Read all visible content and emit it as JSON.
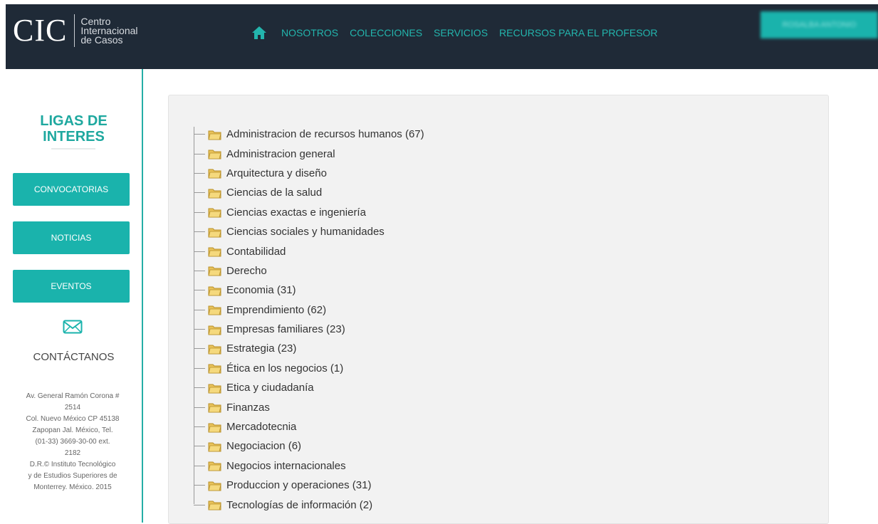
{
  "header": {
    "logo_main": "CIC",
    "logo_line1": "Centro",
    "logo_line2": "Internacional",
    "logo_line3": "de Casos",
    "home_icon": "home-icon",
    "nav_items": [
      "NOSOTROS",
      "COLECCIONES",
      "SERVICIOS",
      "RECURSOS PARA EL PROFESOR"
    ],
    "user_button": "ROSALBA ANTONIO",
    "accent_color": "#1ab3ac",
    "background_color": "#1f2a37"
  },
  "sidebar": {
    "title": "LIGAS DE INTERES",
    "buttons": [
      "CONVOCATORIAS",
      "NOTICIAS",
      "EVENTOS"
    ],
    "mail_icon": "envelope-icon",
    "contact_title": "CONTÁCTANOS",
    "address_lines": [
      "Av. General Ramón Corona #",
      "2514",
      "Col. Nuevo México CP 45138",
      "Zapopan Jal. México, Tel.",
      "(01-33) 3669-30-00 ext.",
      "2182",
      "D.R.© Instituto Tecnológico",
      "y de Estudios Superiores de",
      "Monterrey. México. 2015"
    ]
  },
  "tree": {
    "folder_icon": "folder-icon",
    "items": [
      "Administracion de recursos humanos (67)",
      "Administracion general",
      "Arquitectura y diseño",
      "Ciencias de la salud",
      "Ciencias exactas e ingeniería",
      "Ciencias sociales y humanidades",
      "Contabilidad",
      "Derecho",
      "Economia (31)",
      "Emprendimiento (62)",
      "Empresas familiares (23)",
      "Estrategia (23)",
      "Ética en los negocios (1)",
      "Etica y ciudadanía",
      "Finanzas",
      "Mercadotecnia",
      "Negociacion (6)",
      "Negocios internacionales",
      "Produccion y operaciones (31)",
      "Tecnologías de información (2)"
    ]
  }
}
